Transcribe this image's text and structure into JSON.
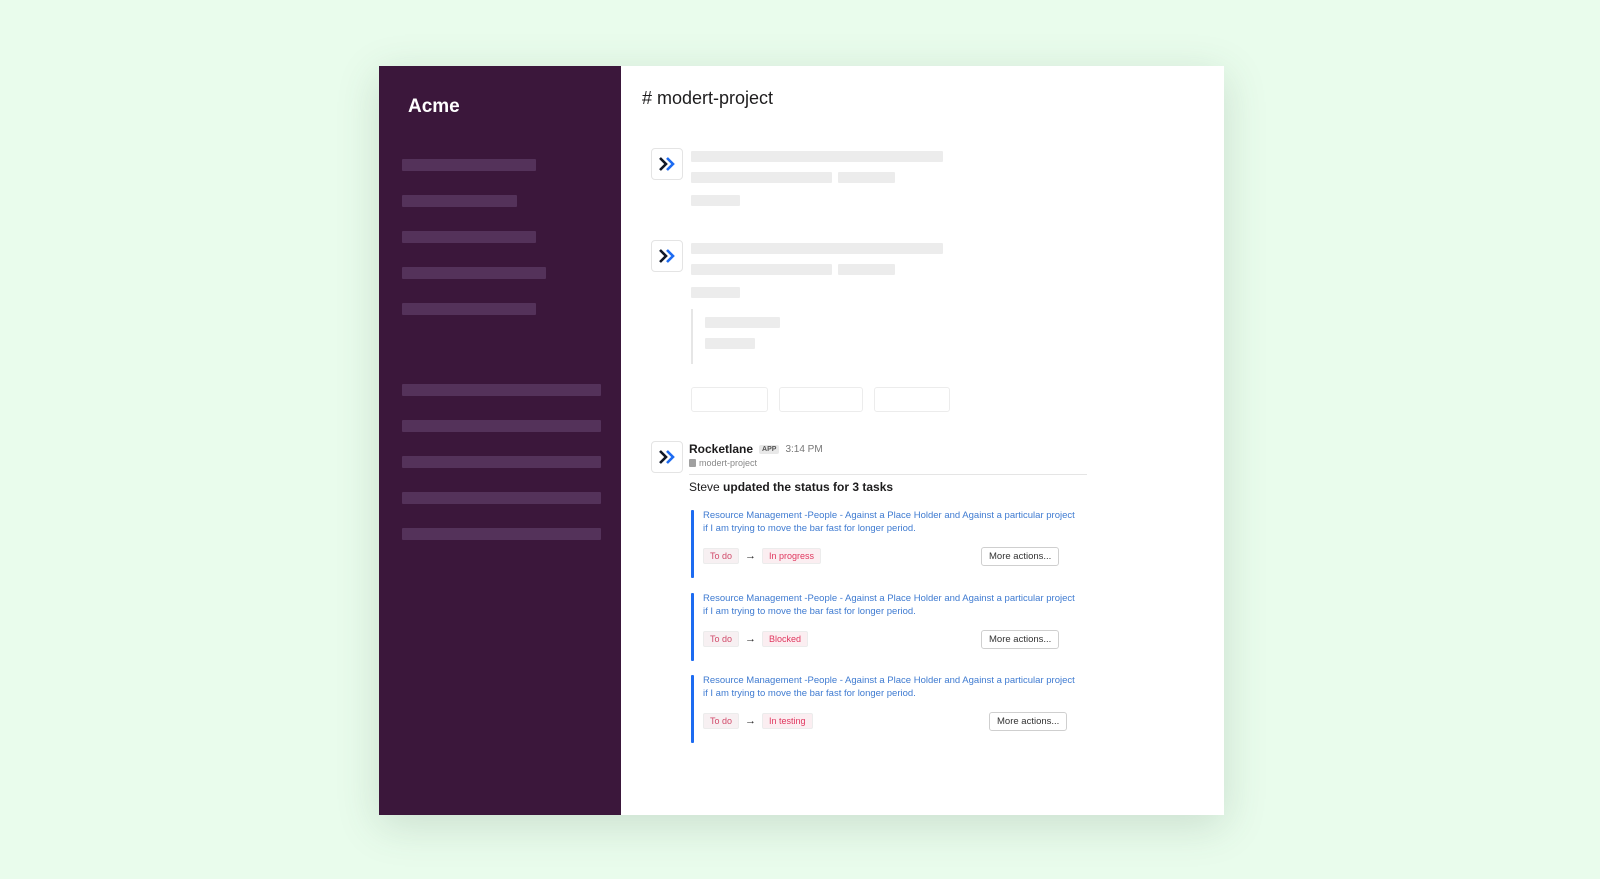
{
  "sidebar": {
    "workspace": "Acme"
  },
  "channel": {
    "title": "# modert-project"
  },
  "message": {
    "bot_name": "Rocketlane",
    "app_badge": "APP",
    "time": "3:14 PM",
    "channel": "modert-project",
    "update_actor": "Steve",
    "update_text": "updated the status for 3 tasks",
    "tasks": [
      {
        "title": "Resource Management  -People - Against a Place Holder and Against a  particular project if I am trying to move the bar fast for longer period.",
        "from": "To do",
        "to": "In progress",
        "action": "More actions..."
      },
      {
        "title": "Resource Management  -People - Against a Place Holder and Against a  particular project if I am trying to move the bar fast for longer period.",
        "from": "To do",
        "to": "Blocked",
        "action": "More actions..."
      },
      {
        "title": "Resource Management  -People - Against a Place Holder and Against a  particular project if I am trying to move the bar fast for longer period.",
        "from": "To do",
        "to": "In testing",
        "action": "More actions..."
      }
    ]
  },
  "colors": {
    "page_bg": "#e9fcec",
    "sidebar_bg": "#3b173b",
    "accent_blue": "#1d6bf1",
    "status_red": "#e0365e"
  },
  "icons": {
    "avatar": "rocketlane-chevron-icon",
    "channel": "document-icon"
  }
}
